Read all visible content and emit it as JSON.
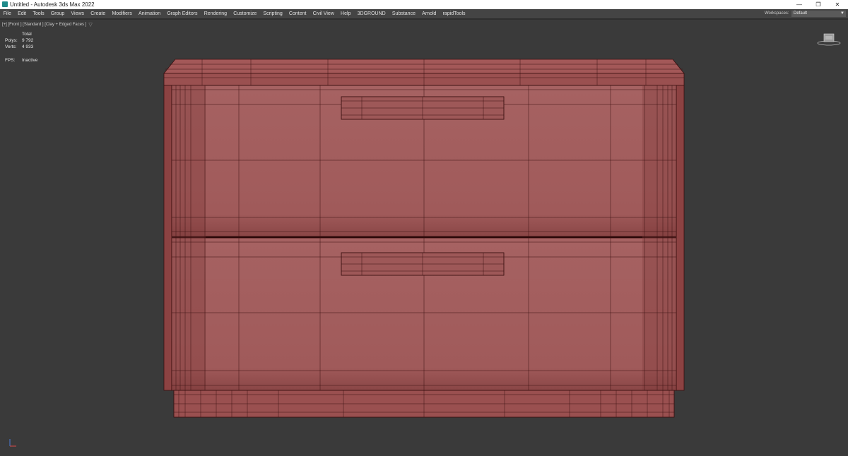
{
  "window": {
    "title": "Untitled - Autodesk 3ds Max 2022",
    "buttons": {
      "minimize": "—",
      "restore": "❐",
      "close": "✕"
    }
  },
  "menubar": {
    "items": [
      "File",
      "Edit",
      "Tools",
      "Group",
      "Views",
      "Create",
      "Modifiers",
      "Animation",
      "Graph Editors",
      "Rendering",
      "Customize",
      "Scripting",
      "Content",
      "Civil View",
      "Help",
      "3DGROUND",
      "Substance",
      "Arnold",
      "rapidTools"
    ],
    "workspaces_label": "Workspaces:",
    "workspace_value": "Default"
  },
  "viewport": {
    "label": "[+] [Front ] [Standard ] [Clay + Edged Faces ]",
    "filter_icon": "funnel-icon",
    "stats": {
      "total_label": "Total",
      "polys_label": "Polys:",
      "polys_value": "9 792",
      "verts_label": "Verts:",
      "verts_value": "4 933",
      "fps_label": "FPS:",
      "fps_value": "Inactive"
    },
    "colors": {
      "background": "#3a3a3a",
      "clay": "#a45f5f",
      "edges": "#3a1010"
    }
  }
}
